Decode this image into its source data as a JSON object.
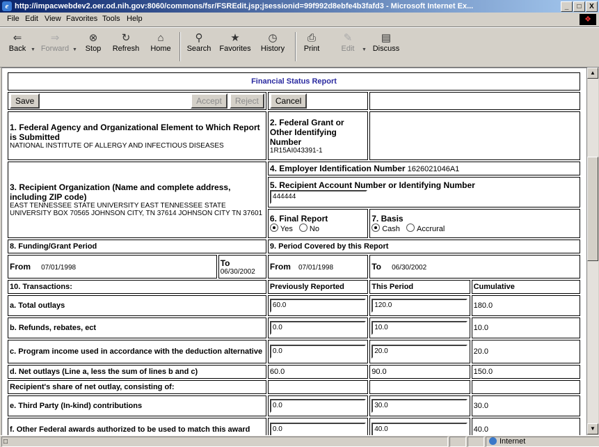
{
  "window": {
    "title": "http://impacwebdev2.oer.od.nih.gov:8060/commons/fsr/FSREdit.jsp;jsessionid=99f992d8ebfe4b3fafd3 - Microsoft Internet Ex...",
    "controls": [
      "_",
      "□",
      "X"
    ]
  },
  "menu": [
    "File",
    "Edit",
    "View",
    "Favorites",
    "Tools",
    "Help"
  ],
  "toolbar": {
    "back": "Back",
    "forward": "Forward",
    "stop": "Stop",
    "refresh": "Refresh",
    "home": "Home",
    "search": "Search",
    "favorites": "Favorites",
    "history": "History",
    "print": "Print",
    "edit": "Edit",
    "discuss": "Discuss"
  },
  "form": {
    "heading": "Financial Status Report",
    "buttons": {
      "save": "Save",
      "accept": "Accept",
      "reject": "Reject",
      "cancel": "Cancel"
    },
    "box1": {
      "label": "1. Federal Agency and Organizational Element to Which Report is Submitted",
      "value": "NATIONAL INSTITUTE OF ALLERGY AND INFECTIOUS DISEASES"
    },
    "box2": {
      "label": "2. Federal Grant or Other Identifying Number",
      "value": "1R15AI043391-1"
    },
    "box3": {
      "label": "3. Recipient Organization (Name and complete address, including ZIP code)",
      "value": "EAST TENNESSEE STATE UNIVERSITY EAST TENNESSEE STATE UNIVERSITY BOX 70565 JOHNSON CITY, TN 37614 JOHNSON CITY TN 37601"
    },
    "box4": {
      "label": "4. Employer Identification Number",
      "value": "1626021046A1"
    },
    "box5": {
      "label": "5. Recipient Account Number or Identifying Number",
      "value": "444444"
    },
    "box6": {
      "label": "6. Final Report",
      "yes": "Yes",
      "no": "No",
      "selected": "Yes"
    },
    "box7": {
      "label": "7. Basis",
      "cash": "Cash",
      "accrual": "Accrural",
      "selected": "Cash"
    },
    "box8": {
      "label": "8. Funding/Grant Period",
      "from_label": "From",
      "from": "07/01/1998",
      "to_label": "To",
      "to": "06/30/2002"
    },
    "box9": {
      "label": "9. Period Covered by this Report",
      "from_label": "From",
      "from": "07/01/1998",
      "to_label": "To",
      "to": "06/30/2002"
    },
    "transactions": {
      "label": "10. Transactions:",
      "columns": [
        "Previously Reported",
        "This Period",
        "Cumulative"
      ],
      "rows": [
        {
          "label": "a. Total outlays",
          "prev": "60.0",
          "this": "120.0",
          "cum": "180.0"
        },
        {
          "label": "b. Refunds, rebates, ect",
          "prev": "0.0",
          "this": "10.0",
          "cum": "10.0"
        },
        {
          "label": "c. Program income used in accordance with the deduction alternative",
          "prev": "0.0",
          "this": "20.0",
          "cum": "20.0"
        },
        {
          "label": "d. Net outlays (Line a, less the sum of lines b and c)",
          "prev": "60.0",
          "this": "90.0",
          "cum": "150.0"
        },
        {
          "label": "Recipient's share of net outlay, consisting of:"
        },
        {
          "label": "e. Third Party (In-kind) contributions",
          "prev": "0.0",
          "this": "30.0",
          "cum": "30.0"
        },
        {
          "label": "f. Other Federal awards authorized to be used to match this award",
          "prev": "0.0",
          "this": "40.0",
          "cum": "40.0"
        }
      ]
    }
  },
  "status": {
    "zone": "Internet"
  }
}
